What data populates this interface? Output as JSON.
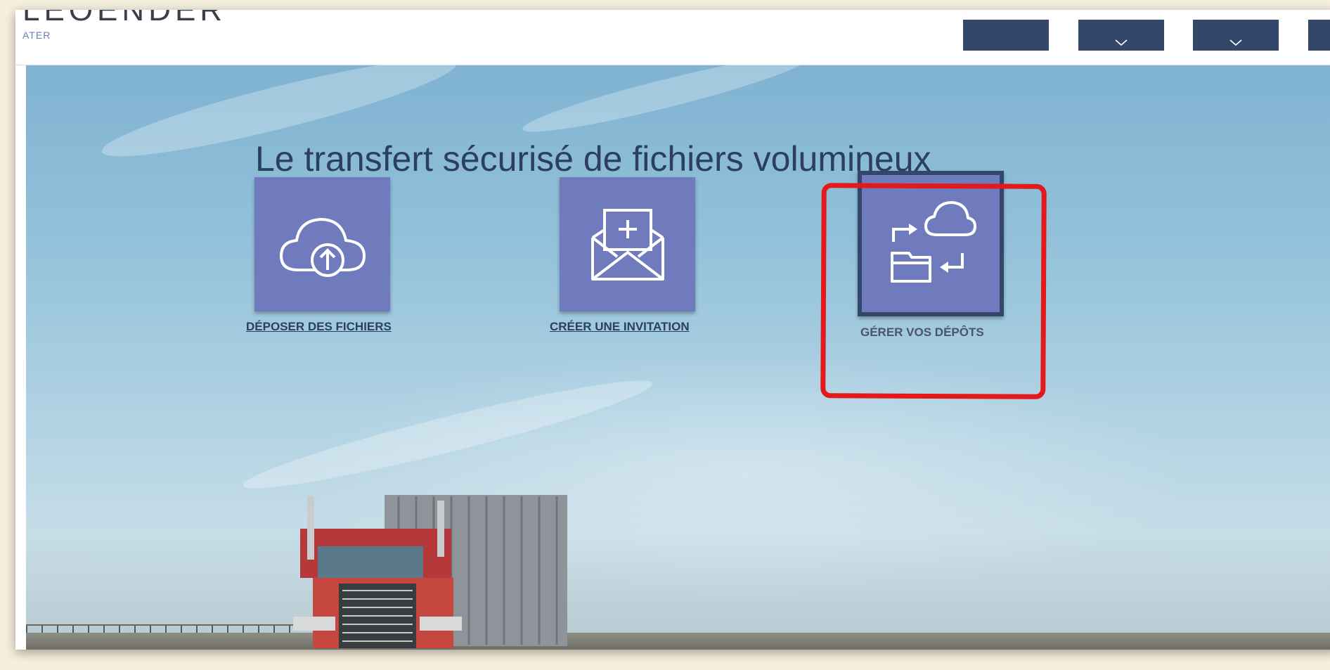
{
  "header": {
    "logo_text": "LEOENDER",
    "logo_sub": "ATER",
    "nav_buttons": [
      {
        "icon": "chevron-down-icon"
      },
      {
        "icon": "chevron-down-icon"
      },
      {
        "icon": "chevron-down-icon"
      },
      {
        "icon": ""
      }
    ]
  },
  "hero": {
    "headline": "Le transfert sécurisé de fichiers volumineux",
    "actions": [
      {
        "label": "DÉPOSER DES FICHIERS",
        "icon": "cloud-upload-icon"
      },
      {
        "label": "CRÉER UNE INVITATION",
        "icon": "envelope-plus-icon"
      },
      {
        "label": "GÉRER VOS DÉPÔTS",
        "icon": "cloud-folder-sync-icon"
      }
    ]
  },
  "colors": {
    "tile": "#6f7bbd",
    "nav": "#33476a",
    "highlight": "#e3191b",
    "headline": "#2d3f60"
  }
}
